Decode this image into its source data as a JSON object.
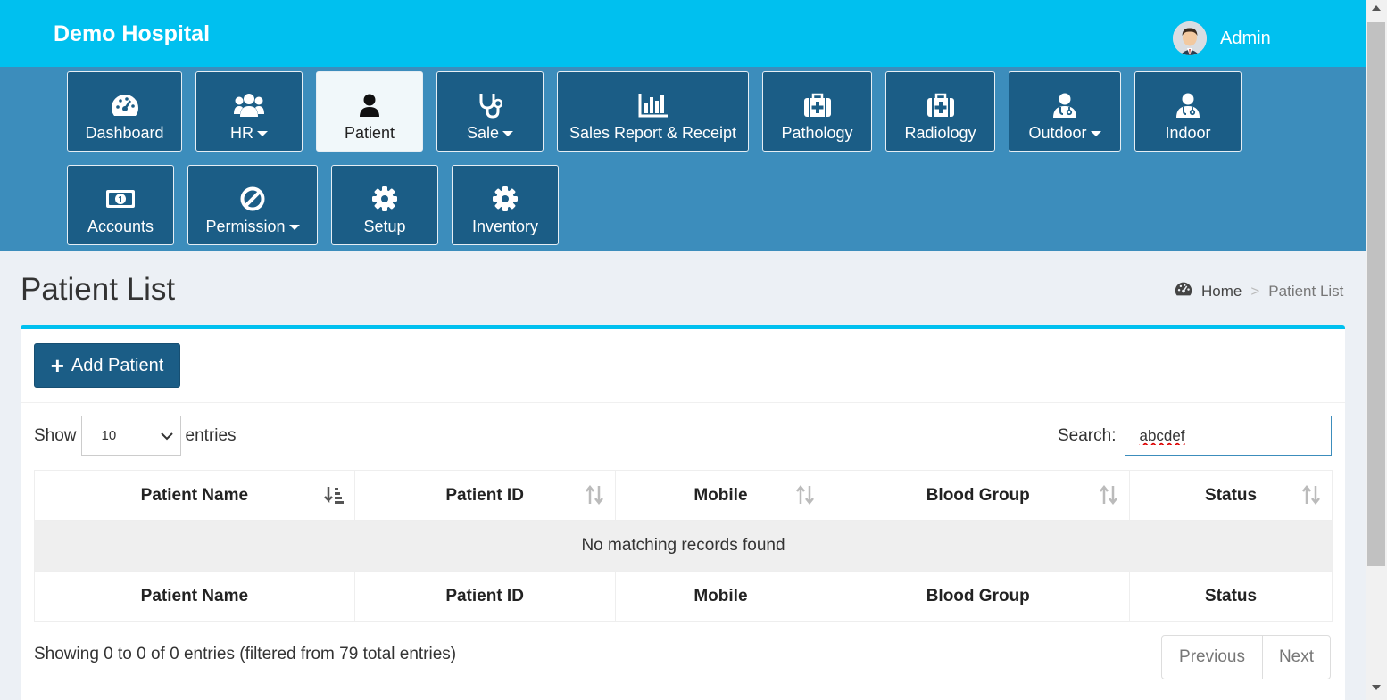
{
  "header": {
    "brand": "Demo Hospital",
    "user_name": "Admin"
  },
  "nav": {
    "dashboard": "Dashboard",
    "hr": "HR",
    "patient": "Patient",
    "sale": "Sale",
    "sales_report": "Sales Report & Receipt",
    "pathology": "Pathology",
    "radiology": "Radiology",
    "outdoor": "Outdoor",
    "indoor": "Indoor",
    "accounts": "Accounts",
    "permission": "Permission",
    "setup": "Setup",
    "inventory": "Inventory"
  },
  "page": {
    "title": "Patient List"
  },
  "breadcrumb": {
    "home": "Home",
    "separator": ">",
    "current": "Patient List"
  },
  "actions": {
    "add_patient": "Add Patient"
  },
  "table_controls": {
    "show_label": "Show",
    "entries_label": "entries",
    "page_size": "10",
    "search_label": "Search:",
    "search_value": "abcdef"
  },
  "table": {
    "columns": [
      "Patient Name",
      "Patient ID",
      "Mobile",
      "Blood Group",
      "Status"
    ],
    "empty_message": "No matching records found"
  },
  "footer": {
    "info": "Showing 0 to 0 of 0 entries (filtered from 79 total entries)",
    "prev": "Previous",
    "next": "Next"
  },
  "colors": {
    "topbar": "#00c0ef",
    "nav_area": "#3c8dbc",
    "nav_button": "#1b5d86"
  }
}
